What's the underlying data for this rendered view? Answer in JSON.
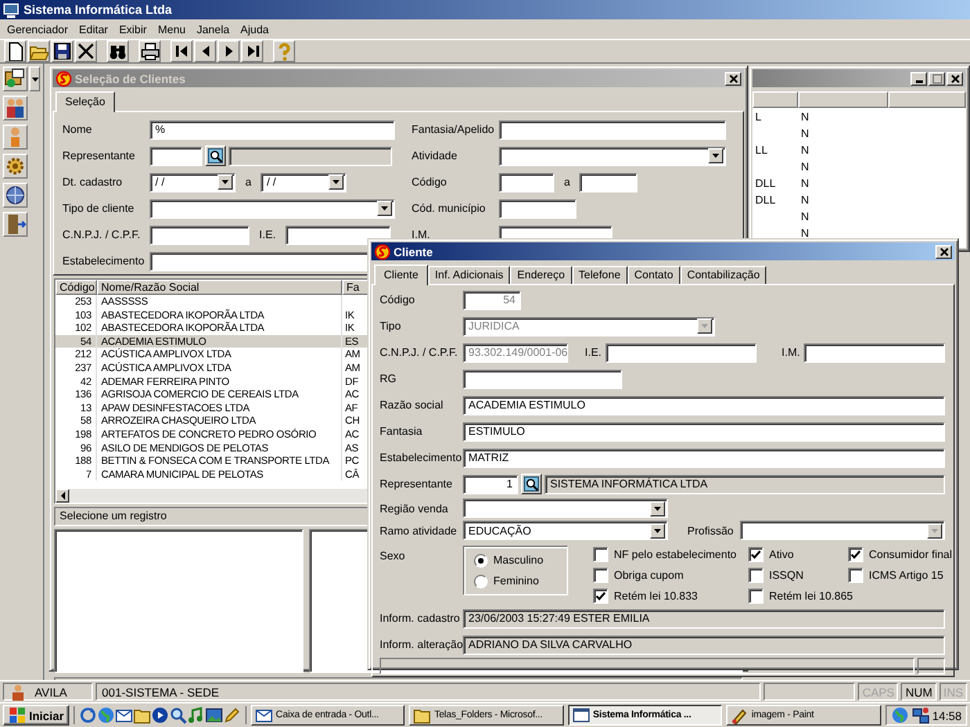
{
  "app": {
    "title": "Sistema Informática Ltda",
    "menu": [
      "Gerenciador",
      "Editar",
      "Exibir",
      "Menu",
      "Janela",
      "Ajuda"
    ]
  },
  "selection_window": {
    "title": "Seleção de Clientes",
    "active": false,
    "tabs": [
      {
        "label": "Seleção",
        "selected": true
      }
    ],
    "filters_left": [
      {
        "kind": "text",
        "label": "Nome",
        "value": "%"
      },
      {
        "kind": "lookup",
        "label": "Representante"
      },
      {
        "kind": "date_range",
        "label": "Dt. cadastro",
        "from": "/ /",
        "separator": "a",
        "to": "/ /"
      },
      {
        "kind": "combo",
        "label": "Tipo de cliente"
      },
      {
        "kind": "pair",
        "label": "C.N.P.J. / C.P.F.",
        "second_label": "I.E."
      },
      {
        "kind": "text",
        "label": "Estabelecimento"
      }
    ],
    "filters_right": [
      {
        "kind": "text",
        "label": "Fantasia/Apelido"
      },
      {
        "kind": "combo",
        "label": "Atividade"
      },
      {
        "kind": "range",
        "label": "Código",
        "separator": "a"
      },
      {
        "kind": "text",
        "label": "Cód. município"
      },
      {
        "kind": "text",
        "label": "I.M."
      }
    ],
    "grid": {
      "columns": [
        "Código",
        "Nome/Razão Social",
        "Fa"
      ],
      "rows": [
        {
          "cells": [
            "253",
            "AASSSSS"
          ],
          "selected": false
        },
        {
          "cells": [
            "103",
            "ABASTECEDORA IKOPORÃA LTDA",
            "IK"
          ],
          "selected": false
        },
        {
          "cells": [
            "102",
            "ABASTECEDORA IKOPORÃA LTDA",
            "IK"
          ],
          "selected": false
        },
        {
          "cells": [
            "54",
            "ACADEMIA ESTIMULO",
            "ES"
          ],
          "selected": true
        },
        {
          "cells": [
            "212",
            "ACÚSTICA AMPLIVOX LTDA",
            "AM"
          ],
          "selected": false
        },
        {
          "cells": [
            "237",
            "ACÚSTICA AMPLIVOX LTDA",
            "AM"
          ],
          "selected": false
        },
        {
          "cells": [
            "42",
            "ADEMAR FERREIRA PINTO",
            "DF"
          ],
          "selected": false
        },
        {
          "cells": [
            "136",
            "AGRISOJA COMERCIO DE CEREAIS LTDA",
            "AC"
          ],
          "selected": false
        },
        {
          "cells": [
            "13",
            "APAW DESINFESTACOES LTDA",
            "AF"
          ],
          "selected": false
        },
        {
          "cells": [
            "58",
            "ARROZEIRA CHASQUEIRO LTDA",
            "CH"
          ],
          "selected": false
        },
        {
          "cells": [
            "198",
            "ARTEFATOS DE CONCRETO PEDRO OSÓRIO",
            "AC"
          ],
          "selected": false
        },
        {
          "cells": [
            "96",
            "ASILO DE MENDIGOS DE PELOTAS",
            "AS"
          ],
          "selected": false
        },
        {
          "cells": [
            "188",
            "BETTIN & FONSECA COM E TRANSPORTE LTDA",
            "PC"
          ],
          "selected": false
        },
        {
          "cells": [
            "7",
            "CAMARA MUNICIPAL DE PELOTAS",
            "CÂ"
          ],
          "selected": false
        }
      ]
    },
    "status": "Selecione um registro"
  },
  "background_window": {
    "active": false,
    "rows": [
      {
        "column_1": "L",
        "column_2": "N"
      },
      {
        "column_2": "N"
      },
      {
        "column_1": "LL",
        "column_2": "N"
      },
      {
        "column_2": "N"
      },
      {
        "column_1": "DLL",
        "column_2": "N"
      },
      {
        "column_1": "DLL",
        "column_2": "N"
      },
      {
        "column_2": "N"
      },
      {
        "column_2": "N"
      }
    ]
  },
  "client_dialog": {
    "title": "Cliente",
    "active": true,
    "tabs": [
      {
        "label": "Cliente",
        "selected": true
      },
      {
        "label": "Inf. Adicionais",
        "selected": false
      },
      {
        "label": "Endereço",
        "selected": false
      },
      {
        "label": "Telefone",
        "selected": false
      },
      {
        "label": "Contato",
        "selected": false
      },
      {
        "label": "Contabilização",
        "selected": false
      }
    ],
    "code": {
      "label": "Código",
      "value": "54",
      "disabled": true
    },
    "type": {
      "label": "Tipo",
      "value": "JURIDICA",
      "disabled": true
    },
    "document": {
      "label": "C.N.P.J. / C.P.F.",
      "value": "93.302.149/0001-06",
      "disabled": true
    },
    "state_registration": {
      "label": "I.E."
    },
    "municipal_registration": {
      "label": "I.M."
    },
    "rg": {
      "label": "RG"
    },
    "company_name": {
      "label": "Razão social",
      "value": "ACADEMIA ESTIMULO"
    },
    "trade_name": {
      "label": "Fantasia",
      "value": "ESTIMULO"
    },
    "establishment": {
      "label": "Estabelecimento",
      "value": "MATRIZ"
    },
    "representative": {
      "label": "Representante",
      "code": "1",
      "name": "SISTEMA INFORMÁTICA LTDA"
    },
    "sales_region": {
      "label": "Região venda"
    },
    "business_line": {
      "label": "Ramo atividade",
      "value": "EDUCAÇÃO"
    },
    "profession": {
      "label": "Profissão",
      "disabled": true
    },
    "sex": {
      "label": "Sexo",
      "options": [
        {
          "label": "Masculino",
          "selected": true
        },
        {
          "label": "Feminino",
          "selected": false
        }
      ]
    },
    "flags": [
      {
        "label": "NF pelo estabelecimento",
        "checked": false
      },
      {
        "label": "Ativo",
        "checked": true
      },
      {
        "label": "Consumidor final",
        "checked": true
      },
      {
        "label": "Obriga cupom",
        "checked": false
      },
      {
        "label": "ISSQN",
        "checked": false
      },
      {
        "label": "ICMS Artigo 15",
        "checked": false
      },
      {
        "label": "Retém lei 10.833",
        "checked": true
      },
      {
        "label": "Retém lei 10.865",
        "checked": false
      }
    ],
    "registration_info": {
      "label": "Inform. cadastro",
      "value": "23/06/2003 15:27:49   ESTER EMILIA"
    },
    "change_info": {
      "label": "Inform. alteração",
      "value": "ADRIANO DA SILVA CARVALHO"
    }
  },
  "status_bar": {
    "user": "AVILA",
    "company": "001-SISTEMA - SEDE",
    "keys": [
      {
        "label": "CAPS",
        "on": false
      },
      {
        "label": "NUM",
        "on": true
      },
      {
        "label": "INS",
        "on": false
      }
    ]
  },
  "taskbar": {
    "start": "Iniciar",
    "tasks": [
      {
        "label": "Caixa de entrada - Outl...",
        "selected": false
      },
      {
        "label": "Telas_Folders - Microsof...",
        "selected": false
      },
      {
        "label": "Sistema Informática ...",
        "selected": true
      },
      {
        "label": "imagem - Paint",
        "selected": false
      }
    ],
    "clock": "14:58"
  }
}
